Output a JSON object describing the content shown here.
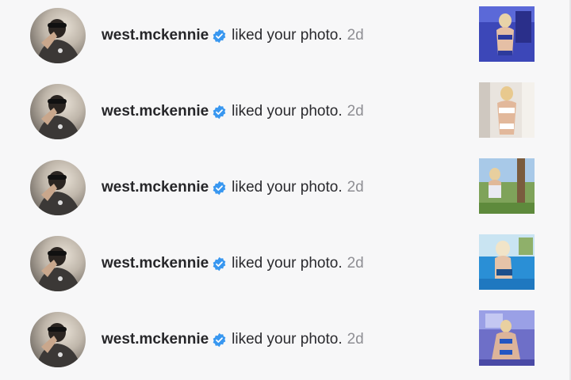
{
  "notifications": [
    {
      "username": "west.mckennie",
      "action": "liked your photo.",
      "time": "2d",
      "verified_icon": "verified-badge-icon",
      "thumb_theme": "blue-room"
    },
    {
      "username": "west.mckennie",
      "action": "liked your photo.",
      "time": "2d",
      "verified_icon": "verified-badge-icon",
      "thumb_theme": "white-room"
    },
    {
      "username": "west.mckennie",
      "action": "liked your photo.",
      "time": "2d",
      "verified_icon": "verified-badge-icon",
      "thumb_theme": "outdoor-palm"
    },
    {
      "username": "west.mckennie",
      "action": "liked your photo.",
      "time": "2d",
      "verified_icon": "verified-badge-icon",
      "thumb_theme": "pool"
    },
    {
      "username": "west.mckennie",
      "action": "liked your photo.",
      "time": "2d",
      "verified_icon": "verified-badge-icon",
      "thumb_theme": "purple-room"
    }
  ],
  "colors": {
    "verified_blue": "#3897f0",
    "text": "#262629",
    "timestamp": "#8e8e93",
    "background": "#f7f7f8"
  }
}
